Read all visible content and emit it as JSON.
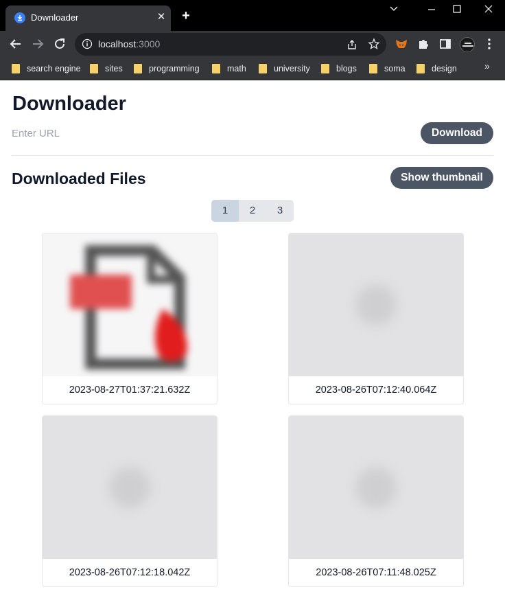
{
  "browser": {
    "tab_title": "Downloader",
    "tab_close": "✕",
    "new_tab": "+",
    "url_host": "localhost",
    "url_port": ":3000",
    "bookmarks": [
      "search engine",
      "sites",
      "programming",
      "math",
      "university",
      "blogs",
      "soma",
      "design"
    ],
    "bookmarks_more": "»"
  },
  "page": {
    "title": "Downloader",
    "url_placeholder": "Enter URL",
    "download_label": "Download",
    "section_title": "Downloaded Files",
    "thumbnail_button": "Show thumbnail",
    "pagination": [
      "1",
      "2",
      "3"
    ],
    "current_page": "1",
    "files": [
      {
        "timestamp": "2023-08-27T01:37:21.632Z",
        "thumbnail": "pdf-file-icon"
      },
      {
        "timestamp": "2023-08-26T07:12:40.064Z",
        "thumbnail": "placeholder-image"
      },
      {
        "timestamp": "2023-08-26T07:12:18.042Z",
        "thumbnail": "placeholder-image"
      },
      {
        "timestamp": "2023-08-26T07:11:48.025Z",
        "thumbnail": "placeholder-image"
      }
    ]
  },
  "colors": {
    "button_bg": "#4b5563",
    "active_page_bg": "#cbd5e1",
    "pager_bg": "#e5e7eb",
    "pdf_red": "#e11d1d"
  }
}
